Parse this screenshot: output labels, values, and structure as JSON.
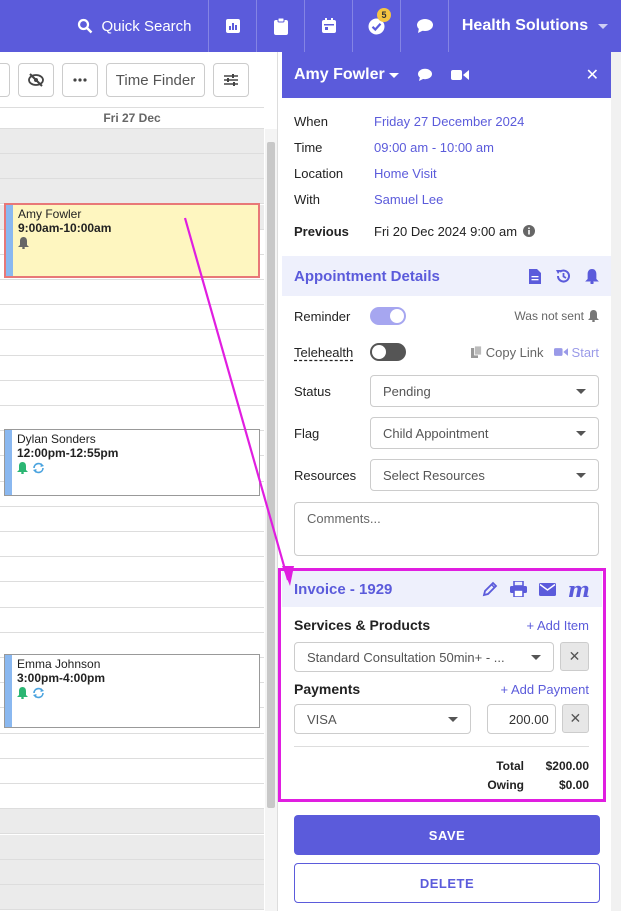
{
  "topbar": {
    "search_label": "Quick Search",
    "notifications_count": "5",
    "org_name": "Health Solutions"
  },
  "calendar": {
    "toolbar": {
      "time_finder": "Time Finder"
    },
    "day_header": "Fri 27 Dec",
    "appointments": [
      {
        "name": "Amy Fowler",
        "time": "9:00am-10:00am"
      },
      {
        "name": "Dylan Sonders",
        "time": "12:00pm-12:55pm"
      },
      {
        "name": "Emma Johnson",
        "time": "3:00pm-4:00pm"
      }
    ]
  },
  "panel": {
    "client_name": "Amy Fowler",
    "info": {
      "when_label": "When",
      "when": "Friday 27 December 2024",
      "time_label": "Time",
      "time": "09:00 am - 10:00 am",
      "location_label": "Location",
      "location": "Home Visit",
      "with_label": "With",
      "with": "Samuel Lee",
      "previous_label": "Previous",
      "previous": "Fri 20 Dec 2024 9:00 am"
    },
    "details": {
      "title": "Appointment Details",
      "reminder_label": "Reminder",
      "reminder_status": "Was not sent",
      "telehealth_label": "Telehealth",
      "copy_link": "Copy Link",
      "start": "Start",
      "status_label": "Status",
      "status_value": "Pending",
      "flag_label": "Flag",
      "flag_value": "Child Appointment",
      "resources_label": "Resources",
      "resources_placeholder": "Select Resources",
      "comments_placeholder": "Comments..."
    },
    "invoice": {
      "title": "Invoice - 1929",
      "services_label": "Services & Products",
      "add_item": "+ Add Item",
      "service_value": "Standard Consultation 50min+ - ...",
      "payments_label": "Payments",
      "add_payment": "+ Add Payment",
      "payment_method": "VISA",
      "payment_amount": "200.00",
      "total_label": "Total",
      "total_value": "$200.00",
      "owing_label": "Owing",
      "owing_value": "$0.00"
    },
    "save_label": "SAVE",
    "delete_label": "DELETE"
  },
  "colors": {
    "brand": "#5b5bdb",
    "highlight": "#e01ee0",
    "active_appt": "#fef6c0"
  }
}
